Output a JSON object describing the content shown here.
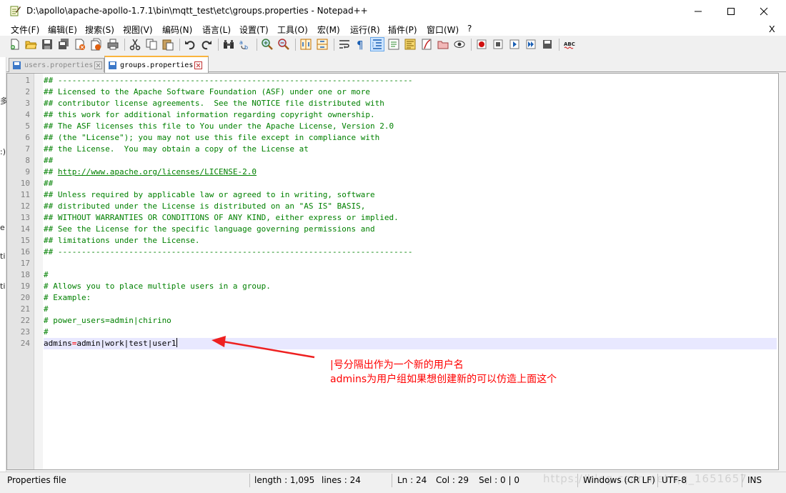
{
  "window": {
    "title": "D:\\apollo\\apache-apollo-1.7.1\\bin\\mqtt_test\\etc\\groups.properties - Notepad++",
    "min_glyph": "—",
    "max_glyph": "☐",
    "close_glyph": "✕"
  },
  "menu": {
    "items": [
      "文件(F)",
      "编辑(E)",
      "搜索(S)",
      "视图(V)",
      "编码(N)",
      "语言(L)",
      "设置(T)",
      "工具(O)",
      "宏(M)",
      "运行(R)",
      "插件(P)",
      "窗口(W)",
      "?"
    ],
    "close_doc": "X"
  },
  "toolbar": {
    "icons": [
      "new-icon",
      "open-icon",
      "save-icon",
      "save-all-icon",
      "close-icon",
      "close-all-icon",
      "print-icon",
      "cut-icon",
      "copy-icon",
      "paste-icon",
      "undo-icon",
      "redo-icon",
      "find-icon",
      "replace-icon",
      "zoom-in-icon",
      "zoom-out-icon",
      "sync-v-icon",
      "sync-h-icon",
      "word-wrap-icon",
      "show-all-chars-icon",
      "indent-guide-icon",
      "udl-icon",
      "doc-map-icon",
      "function-list-icon",
      "folder-workspace-icon",
      "monitor-icon",
      "record-macro-icon",
      "stop-macro-icon",
      "play-macro-icon",
      "run-macro-multiple-icon",
      "save-macro-icon",
      "spell-check-icon"
    ]
  },
  "tabs": [
    {
      "label": "users.properties",
      "active": false
    },
    {
      "label": "groups.properties",
      "active": true
    }
  ],
  "background_window": {
    "fragments": [
      "多",
      ":)",
      "e",
      "ti",
      "ti"
    ]
  },
  "editor": {
    "lines": [
      {
        "n": "1",
        "text": "## ---------------------------------------------------------------------------"
      },
      {
        "n": "2",
        "text": "## Licensed to the Apache Software Foundation (ASF) under one or more"
      },
      {
        "n": "3",
        "text": "## contributor license agreements.  See the NOTICE file distributed with"
      },
      {
        "n": "4",
        "text": "## this work for additional information regarding copyright ownership."
      },
      {
        "n": "5",
        "text": "## The ASF licenses this file to You under the Apache License, Version 2.0"
      },
      {
        "n": "6",
        "text": "## (the \"License\"); you may not use this file except in compliance with"
      },
      {
        "n": "7",
        "text": "## the License.  You may obtain a copy of the License at"
      },
      {
        "n": "8",
        "text": "##"
      },
      {
        "n": "9",
        "text": "## ",
        "link": "http://www.apache.org/licenses/LICENSE-2.0"
      },
      {
        "n": "10",
        "text": "##"
      },
      {
        "n": "11",
        "text": "## Unless required by applicable law or agreed to in writing, software"
      },
      {
        "n": "12",
        "text": "## distributed under the License is distributed on an \"AS IS\" BASIS,"
      },
      {
        "n": "13",
        "text": "## WITHOUT WARRANTIES OR CONDITIONS OF ANY KIND, either express or implied."
      },
      {
        "n": "14",
        "text": "## See the License for the specific language governing permissions and"
      },
      {
        "n": "15",
        "text": "## limitations under the License."
      },
      {
        "n": "16",
        "text": "## ---------------------------------------------------------------------------"
      },
      {
        "n": "17",
        "text": ""
      },
      {
        "n": "18",
        "text": "#"
      },
      {
        "n": "19",
        "text": "# Allows you to place multiple users in a group."
      },
      {
        "n": "20",
        "text": "# Example:"
      },
      {
        "n": "21",
        "text": "#"
      },
      {
        "n": "22",
        "text": "# power_users=admin|chirino"
      },
      {
        "n": "23",
        "text": "#"
      }
    ],
    "current_line": {
      "n": "24",
      "key": "admins",
      "eq": "=",
      "value": "admin|work|test|user1"
    }
  },
  "annotation": {
    "line1": "|号分隔出作为一个新的用户名",
    "line2": "admins为用户组如果想创建新的可以仿造上面这个",
    "color": "#ff0000"
  },
  "statusbar": {
    "file_type": "Properties file",
    "length": "length : 1,095",
    "lines": "lines : 24",
    "ln": "Ln : 24",
    "col": "Col : 29",
    "sel": "Sel : 0 | 0",
    "eol": "Windows (CR LF)",
    "encoding": "UTF-8",
    "mode": "INS",
    "watermark": "https://blog.csdn.net/qq_1651657"
  }
}
